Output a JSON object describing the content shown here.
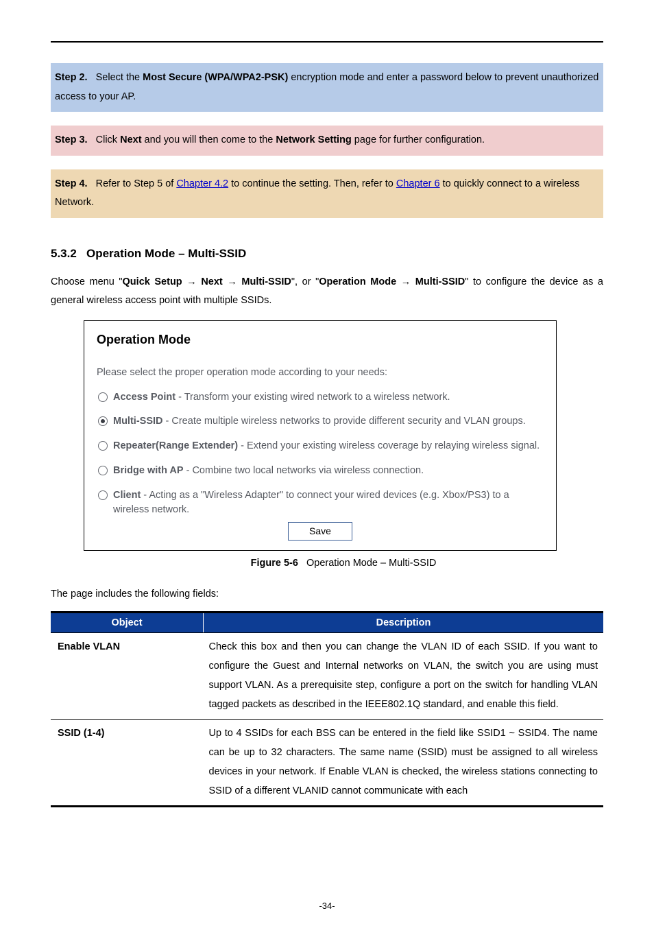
{
  "steps": {
    "s2_label": "Step 2.",
    "s2_pre": "Select the ",
    "s2_bold": "Most Secure (WPA/WPA2-PSK)",
    "s2_post": " encryption mode and enter a password below to prevent unauthorized access to your AP.",
    "s3_label": "Step 3.",
    "s3_pre": "Click ",
    "s3_bold1": "Next",
    "s3_mid": " and you will then come to the ",
    "s3_bold2": "Network Setting",
    "s3_post": " page for further configuration.",
    "s4_label": "Step 4.",
    "s4_pre": "Refer to Step 5 of ",
    "s4_link1": "Chapter 4.2",
    "s4_mid": " to continue the setting. Then, refer to ",
    "s4_link2": "Chapter 6",
    "s4_post": " to quickly connect to a wireless Network."
  },
  "section": {
    "number": "5.3.2",
    "title": "Operation Mode – Multi-SSID"
  },
  "intro": {
    "pre": "Choose menu \"",
    "b1": "Quick Setup",
    "arrow": " → ",
    "b2": "Next",
    "b3": "Multi-SSID",
    "mid1": "\", or \"",
    "b4": "Operation Mode",
    "b5": "Multi-SSID",
    "post": "\" to configure the device as a general wireless access point with multiple SSIDs."
  },
  "figure": {
    "heading": "Operation Mode",
    "lead": "Please select the proper operation mode according to your needs:",
    "options": [
      {
        "label": "Access Point",
        "desc": " - Transform your existing wired network to a wireless network.",
        "selected": false
      },
      {
        "label": "Multi-SSID",
        "desc": " - Create multiple wireless networks to provide different security and VLAN groups.",
        "selected": true
      },
      {
        "label": "Repeater(Range Extender)",
        "desc": " - Extend your existing wireless coverage by relaying wireless signal.",
        "selected": false
      },
      {
        "label": "Bridge with AP",
        "desc": " - Combine two local networks via wireless connection.",
        "selected": false
      },
      {
        "label": "Client",
        "desc": " - Acting as a \"Wireless Adapter\" to connect your wired devices (e.g. Xbox/PS3) to a wireless network.",
        "selected": false
      }
    ],
    "save": "Save",
    "caption_label": "Figure 5-6",
    "caption_text": "Operation Mode – Multi-SSID"
  },
  "fields_caption": "The page includes the following fields:",
  "table": {
    "head_object": "Object",
    "head_description": "Description",
    "rows": [
      {
        "object": "Enable VLAN",
        "description": "Check this box and then you can change the VLAN ID of each SSID. If you want to configure the Guest and Internal networks on VLAN, the switch you are using must support VLAN. As a prerequisite step, configure a port on the switch for handling VLAN tagged packets as described in the IEEE802.1Q standard, and enable this field."
      },
      {
        "object": "SSID (1-4)",
        "description": "Up to 4 SSIDs for each BSS can be entered in the field like SSID1 ~ SSID4. The name can be up to 32 characters. The same name (SSID) must be assigned to all wireless devices in your network. If Enable VLAN is checked, the wireless stations connecting to SSID of a different VLANID cannot communicate with each"
      }
    ]
  },
  "page_number": "-34-"
}
